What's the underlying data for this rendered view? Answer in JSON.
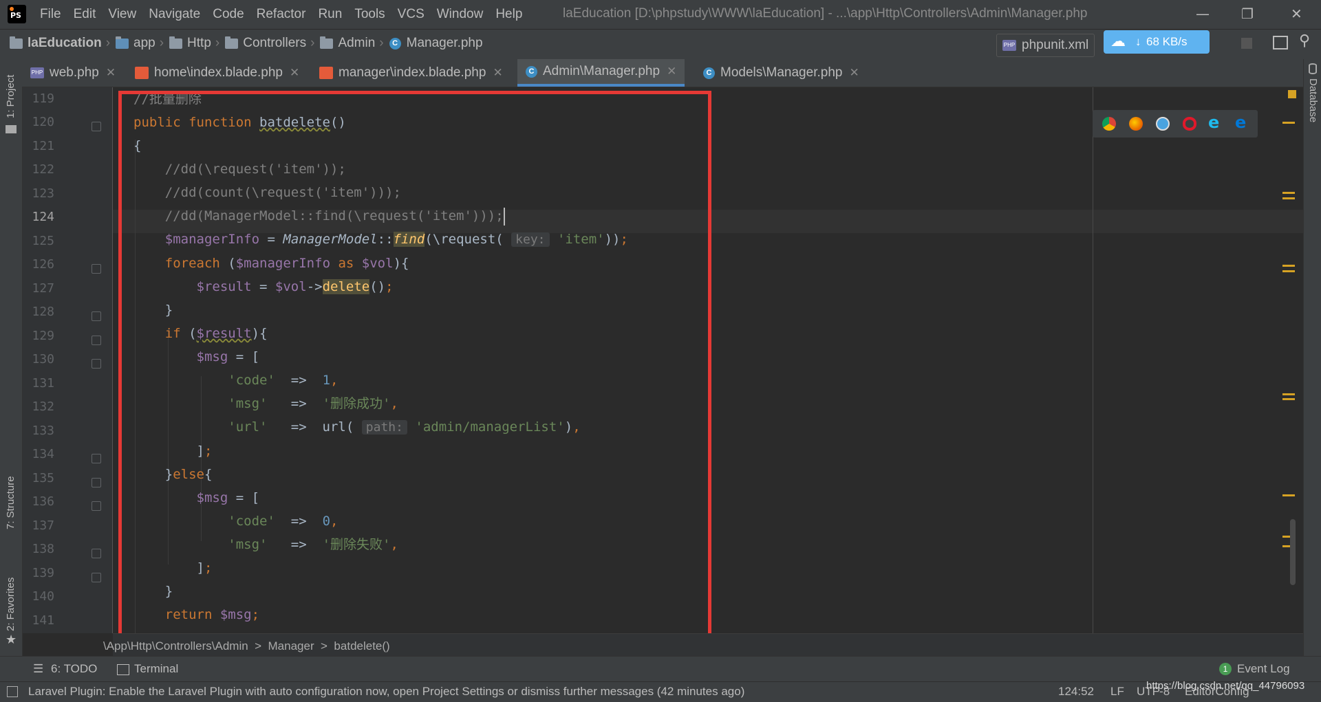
{
  "app": {
    "menu": [
      "File",
      "Edit",
      "View",
      "Navigate",
      "Code",
      "Refactor",
      "Run",
      "Tools",
      "VCS",
      "Window",
      "Help"
    ],
    "window_title": "laEducation [D:\\phpstudy\\WWW\\laEducation] - ...\\app\\Http\\Controllers\\Admin\\Manager.php"
  },
  "breadcrumb": [
    "laEducation",
    "app",
    "Http",
    "Controllers",
    "Admin",
    "Manager.php"
  ],
  "toolbar": {
    "run_config": "phpunit.xml",
    "net_speed": "68 KB/s"
  },
  "tabs": [
    {
      "label": "web.php",
      "icon": "php-icon"
    },
    {
      "label": "home\\index.blade.php",
      "icon": "blade-icon"
    },
    {
      "label": "manager\\index.blade.php",
      "icon": "blade-icon"
    },
    {
      "label": "Admin\\Manager.php",
      "icon": "class-icon",
      "active": true
    },
    {
      "label": "Models\\Manager.php",
      "icon": "class-icon"
    }
  ],
  "left_strip": {
    "project": "1: Project",
    "structure": "7: Structure",
    "favorites": "2: Favorites"
  },
  "right_strip": {
    "database": "Database"
  },
  "editor": {
    "lines": [
      119,
      120,
      121,
      122,
      123,
      124,
      125,
      126,
      127,
      128,
      129,
      130,
      131,
      132,
      133,
      134,
      135,
      136,
      137,
      138,
      139,
      140,
      141
    ],
    "current_line": 124,
    "hints": {
      "key": "key:",
      "path": "path:"
    }
  },
  "code_breadcrumb": "\\App\\Http\\Controllers\\Admin  >  Manager  >  batdelete()",
  "tool_windows": {
    "todo": "6: TODO",
    "terminal": "Terminal",
    "event_log": "Event Log",
    "event_count": "1"
  },
  "status": {
    "message": "Laravel Plugin: Enable the Laravel Plugin with auto configuration now, open Project Settings or dismiss further messages (42 minutes ago)",
    "position": "124:52",
    "line_sep": "LF",
    "encoding": "UTF-8",
    "watermark": "https://blog.csdn.net/qq_44796093",
    "editor_config": "EditorConfig"
  },
  "colors": {
    "highlight_box": "#e53935",
    "keyword": "#cc7832",
    "variable": "#9876aa",
    "string": "#6a8759",
    "number": "#6897bb"
  }
}
